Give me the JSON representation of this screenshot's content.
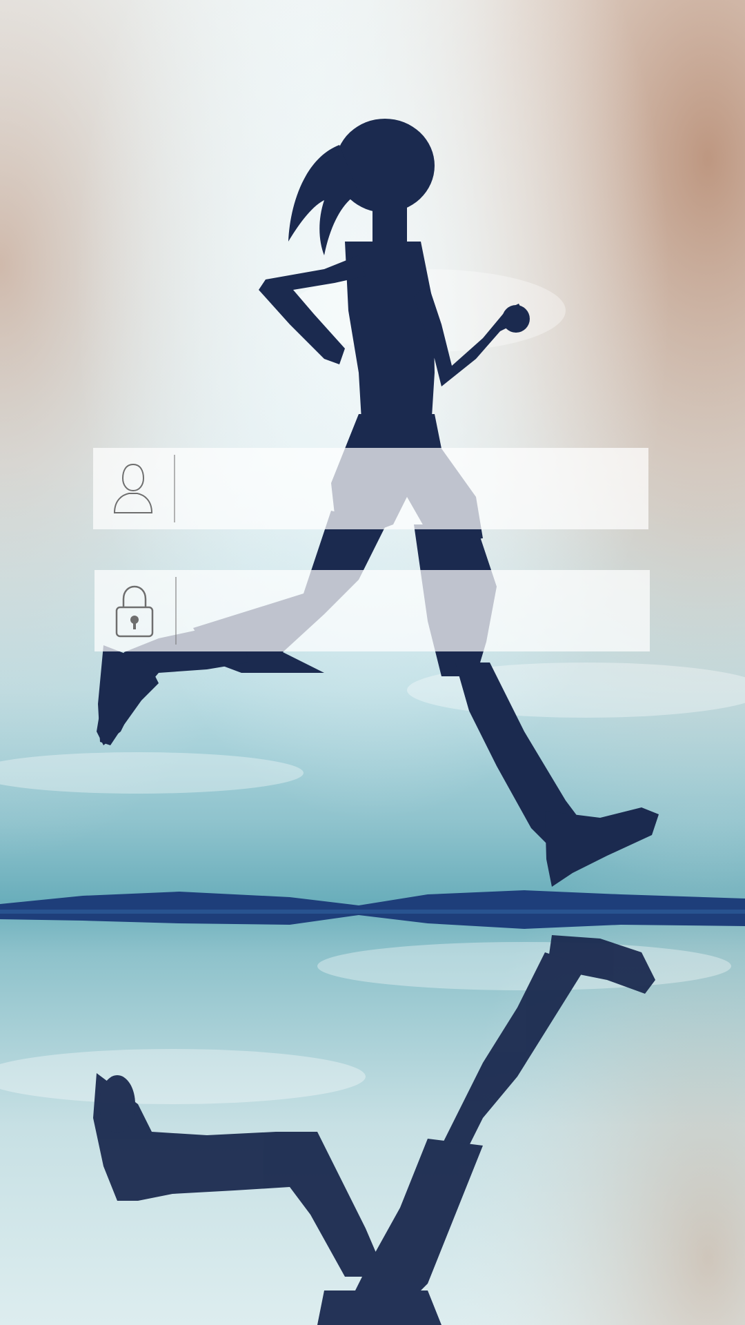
{
  "screen": {
    "background": "running-silhouette-reflection-image"
  },
  "login": {
    "username": {
      "icon": "user-icon",
      "value": "",
      "placeholder": ""
    },
    "password": {
      "icon": "lock-icon",
      "value": "",
      "placeholder": ""
    }
  },
  "colors": {
    "sky_light": "#E6F2F5",
    "sky_teal": "#7FB8C4",
    "sky_warm": "#C9A48C",
    "silhouette": "#1B2A4F",
    "horizon": "#1E3E7A",
    "field_bg": "#FFFFFF",
    "icon_stroke": "#6E6E6E"
  }
}
